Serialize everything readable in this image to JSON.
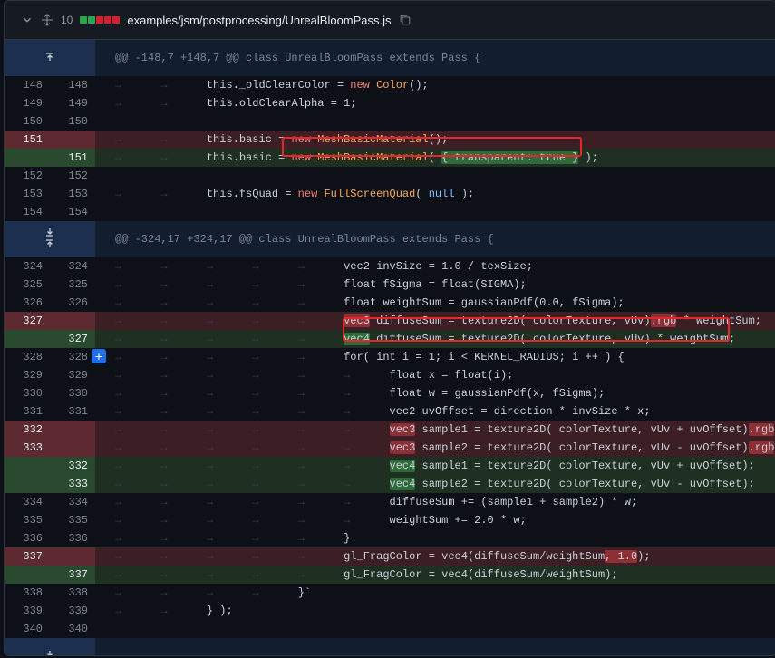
{
  "file": {
    "changes_count": "10",
    "name": "examples/jsm/postprocessing/UnrealBloomPass.js",
    "diffstat_colors": [
      "#2da44e",
      "#2da44e",
      "#cf222e",
      "#cf222e",
      "#cf222e"
    ]
  },
  "hunks": [
    "@@ -148,7 +148,7 @@ class UnrealBloomPass extends Pass {",
    "@@ -324,17 +324,17 @@ class UnrealBloomPass extends Pass {"
  ],
  "rows": [
    {
      "kind": "hunk",
      "h": 0,
      "arrows": "up"
    },
    {
      "kind": "ctx",
      "old": "148",
      "new": "148",
      "tabs": 2,
      "segs": [
        [
          "plain",
          "this._oldClearColor = "
        ],
        [
          "kw",
          "new "
        ],
        [
          "cls",
          "Color"
        ],
        [
          "plain",
          "();"
        ]
      ]
    },
    {
      "kind": "ctx",
      "old": "149",
      "new": "149",
      "tabs": 2,
      "segs": [
        [
          "plain",
          "this.oldClearAlpha = 1;"
        ]
      ]
    },
    {
      "kind": "ctx",
      "old": "150",
      "new": "150",
      "tabs": 0,
      "segs": []
    },
    {
      "kind": "del",
      "old": "151",
      "new": "",
      "tabs": 2,
      "segs": [
        [
          "plain",
          "this.basic = "
        ],
        [
          "kw",
          "new "
        ],
        [
          "cls",
          "MeshBasicMaterial"
        ],
        [
          "plain",
          "();"
        ]
      ]
    },
    {
      "kind": "add",
      "old": "",
      "new": "151",
      "tabs": 2,
      "segs": [
        [
          "plain",
          "this.basic = "
        ],
        [
          "kw",
          "new "
        ],
        [
          "cls",
          "MeshBasicMaterial"
        ],
        [
          "plain",
          "( "
        ],
        [
          "hl-add",
          "{ transparent: true }"
        ],
        [
          "plain",
          " );"
        ]
      ]
    },
    {
      "kind": "ctx",
      "old": "152",
      "new": "152",
      "tabs": 0,
      "segs": []
    },
    {
      "kind": "ctx",
      "old": "153",
      "new": "153",
      "tabs": 2,
      "segs": [
        [
          "plain",
          "this.fsQuad = "
        ],
        [
          "kw",
          "new "
        ],
        [
          "cls",
          "FullScreenQuad"
        ],
        [
          "plain",
          "( "
        ],
        [
          "lit",
          "null"
        ],
        [
          "plain",
          " );"
        ]
      ]
    },
    {
      "kind": "ctx",
      "old": "154",
      "new": "154",
      "tabs": 0,
      "segs": []
    },
    {
      "kind": "hunk",
      "h": 1,
      "arrows": "both"
    },
    {
      "kind": "ctx",
      "old": "324",
      "new": "324",
      "tabs": 5,
      "segs": [
        [
          "plain",
          "vec2 invSize = 1.0 / texSize;"
        ]
      ]
    },
    {
      "kind": "ctx",
      "old": "325",
      "new": "325",
      "tabs": 5,
      "segs": [
        [
          "plain",
          "float fSigma = float(SIGMA);"
        ]
      ]
    },
    {
      "kind": "ctx",
      "old": "326",
      "new": "326",
      "tabs": 5,
      "segs": [
        [
          "plain",
          "float weightSum = gaussianPdf(0.0, fSigma);"
        ]
      ]
    },
    {
      "kind": "del",
      "old": "327",
      "new": "",
      "tabs": 5,
      "segs": [
        [
          "hl-del",
          "vec3"
        ],
        [
          "plain",
          " diffuseSum = texture2D( colorTexture, vUv)"
        ],
        [
          "hl-del",
          ".rgb"
        ],
        [
          "plain",
          " * weightSum;"
        ]
      ]
    },
    {
      "kind": "add",
      "old": "",
      "new": "327",
      "tabs": 5,
      "segs": [
        [
          "hl-add",
          "vec4"
        ],
        [
          "plain",
          " diffuseSum = texture2D( colorTexture, vUv) * weightSum;"
        ]
      ]
    },
    {
      "kind": "ctx",
      "old": "328",
      "new": "328",
      "tabs": 5,
      "plus": true,
      "segs": [
        [
          "plain",
          "for( int i = 1; i < KERNEL_RADIUS; i ++ ) {"
        ]
      ]
    },
    {
      "kind": "ctx",
      "old": "329",
      "new": "329",
      "tabs": 6,
      "segs": [
        [
          "plain",
          "float x = float(i);"
        ]
      ]
    },
    {
      "kind": "ctx",
      "old": "330",
      "new": "330",
      "tabs": 6,
      "segs": [
        [
          "plain",
          "float w = gaussianPdf(x, fSigma);"
        ]
      ]
    },
    {
      "kind": "ctx",
      "old": "331",
      "new": "331",
      "tabs": 6,
      "segs": [
        [
          "plain",
          "vec2 uvOffset = direction * invSize * x;"
        ]
      ]
    },
    {
      "kind": "del",
      "old": "332",
      "new": "",
      "tabs": 6,
      "segs": [
        [
          "hl-del",
          "vec3"
        ],
        [
          "plain",
          " sample1 = texture2D( colorTexture, vUv + uvOffset)"
        ],
        [
          "hl-del",
          ".rgb"
        ],
        [
          "plain",
          ";"
        ]
      ]
    },
    {
      "kind": "del",
      "old": "333",
      "new": "",
      "tabs": 6,
      "segs": [
        [
          "hl-del",
          "vec3"
        ],
        [
          "plain",
          " sample2 = texture2D( colorTexture, vUv - uvOffset)"
        ],
        [
          "hl-del",
          ".rgb"
        ],
        [
          "plain",
          ";"
        ]
      ]
    },
    {
      "kind": "add",
      "old": "",
      "new": "332",
      "tabs": 6,
      "segs": [
        [
          "hl-add",
          "vec4"
        ],
        [
          "plain",
          " sample1 = texture2D( colorTexture, vUv + uvOffset);"
        ]
      ]
    },
    {
      "kind": "add",
      "old": "",
      "new": "333",
      "tabs": 6,
      "segs": [
        [
          "hl-add",
          "vec4"
        ],
        [
          "plain",
          " sample2 = texture2D( colorTexture, vUv - uvOffset);"
        ]
      ]
    },
    {
      "kind": "ctx",
      "old": "334",
      "new": "334",
      "tabs": 6,
      "segs": [
        [
          "plain",
          "diffuseSum += (sample1 + sample2) * w;"
        ]
      ]
    },
    {
      "kind": "ctx",
      "old": "335",
      "new": "335",
      "tabs": 6,
      "segs": [
        [
          "plain",
          "weightSum += 2.0 * w;"
        ]
      ]
    },
    {
      "kind": "ctx",
      "old": "336",
      "new": "336",
      "tabs": 5,
      "segs": [
        [
          "plain",
          "}"
        ]
      ]
    },
    {
      "kind": "del",
      "old": "337",
      "new": "",
      "tabs": 5,
      "segs": [
        [
          "plain",
          "gl_FragColor = vec4(diffuseSum/weightSum"
        ],
        [
          "hl-del",
          ", 1.0"
        ],
        [
          "plain",
          ");"
        ]
      ]
    },
    {
      "kind": "add",
      "old": "",
      "new": "337",
      "tabs": 5,
      "segs": [
        [
          "plain",
          "gl_FragColor = vec4(diffuseSum/weightSum);"
        ]
      ]
    },
    {
      "kind": "ctx",
      "old": "338",
      "new": "338",
      "tabs": 4,
      "segs": [
        [
          "plain",
          "}`"
        ]
      ]
    },
    {
      "kind": "ctx",
      "old": "339",
      "new": "339",
      "tabs": 2,
      "segs": [
        [
          "plain",
          "} );"
        ]
      ]
    },
    {
      "kind": "ctx",
      "old": "340",
      "new": "340",
      "tabs": 0,
      "segs": []
    },
    {
      "kind": "expand",
      "arrows": "down"
    }
  ]
}
